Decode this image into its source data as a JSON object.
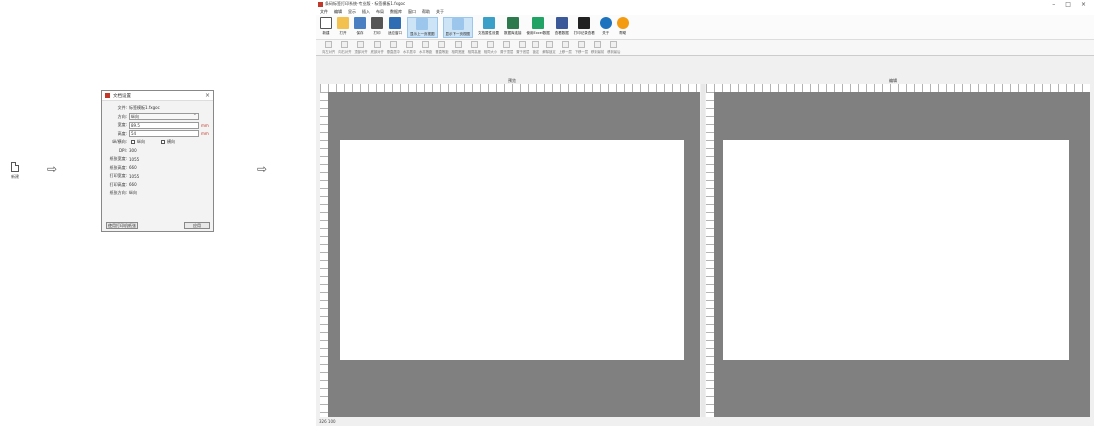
{
  "step_new": {
    "label": "新建"
  },
  "arrows": [
    "⇨",
    "⇨"
  ],
  "dialog": {
    "title": "文档设置",
    "close": "×",
    "fields": [
      {
        "label": "文件:",
        "value": "标签模板1.fxgoc"
      },
      {
        "label": "方向:",
        "value": "纵向"
      },
      {
        "label": "宽度:",
        "value": "89.5",
        "unit": "mm"
      },
      {
        "label": "高度:",
        "value": "54",
        "unit": "mm"
      }
    ],
    "check_row": {
      "label": "纵/横向:",
      "opt1": "纵向",
      "opt2": "横向"
    },
    "info": [
      {
        "label": "DPI:",
        "value": "300"
      },
      {
        "label": "纸张宽度:",
        "value": "1055"
      },
      {
        "label": "纸张高度:",
        "value": "660"
      },
      {
        "label": "打印宽度:",
        "value": "1055"
      },
      {
        "label": "打印高度:",
        "value": "660"
      },
      {
        "label": "纸张方向:",
        "value": "纵向"
      }
    ],
    "left_button": "使用打印机纸张",
    "right_button": "应用"
  },
  "app": {
    "title": "条码标签打印系统-专业版 - 标签模板1.fxgoc",
    "window_controls": [
      "–",
      "□",
      "×"
    ],
    "menu": [
      "文件",
      "编辑",
      "显示",
      "插入",
      "布局",
      "数据库",
      "窗口",
      "帮助",
      "关于"
    ],
    "ribbon": [
      {
        "label": "新建",
        "icon": "new-doc-icon",
        "color": "#ffffff"
      },
      {
        "label": "打开",
        "icon": "folder-icon",
        "color": "#f2c14e"
      },
      {
        "label": "保存",
        "icon": "save-icon",
        "color": "#4a7fc1"
      },
      {
        "label": "打印",
        "icon": "printer-icon",
        "color": "#555555"
      },
      {
        "label": "适应窗口",
        "icon": "fit-window-icon",
        "color": "#2e6db4"
      },
      {
        "label": "显示上一页视图",
        "icon": "prev-view-icon",
        "color": "#9cc6ec",
        "active": true
      },
      {
        "label": "显示下一页视图",
        "icon": "next-view-icon",
        "color": "#9cc6ec",
        "active": true
      },
      {
        "label": "文档属性设置",
        "icon": "gear-icon",
        "color": "#3aa0c8"
      },
      {
        "label": "数据库连接",
        "icon": "database-icon",
        "color": "#2d7a4f"
      },
      {
        "label": "使用Excel数据",
        "icon": "excel-icon",
        "color": "#21a366"
      },
      {
        "label": "查看数据",
        "icon": "view-data-icon",
        "color": "#3b5998"
      },
      {
        "label": "打印记录查看",
        "icon": "print-log-icon",
        "color": "#222222"
      },
      {
        "label": "关于",
        "icon": "info-icon",
        "color": "#1e73be"
      },
      {
        "label": "帮助",
        "icon": "help-icon",
        "color": "#f39c12"
      }
    ],
    "toolbar": [
      "向左对齐",
      "向右对齐",
      "顶部对齐",
      "底部对齐",
      "垂直居中",
      "水平居中",
      "水平等距",
      "垂直等距",
      "相同宽度",
      "相同高度",
      "相同大小",
      "置于顶层",
      "置于底层",
      "锁定",
      "解除锁定",
      "上移一层",
      "下移一层",
      "移到最前",
      "移到最后"
    ],
    "pane_labels": [
      "预览",
      "编辑"
    ],
    "status": "326 100"
  }
}
